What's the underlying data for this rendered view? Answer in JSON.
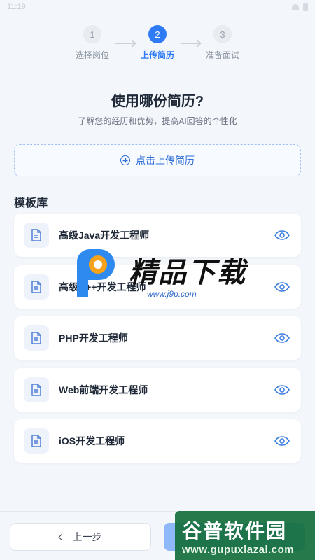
{
  "status_bar": {
    "time": "11:19"
  },
  "stepper": {
    "steps": [
      {
        "num": "1",
        "label": "选择岗位",
        "state": "done"
      },
      {
        "num": "2",
        "label": "上传简历",
        "state": "active"
      },
      {
        "num": "3",
        "label": "准备面试",
        "state": "todo"
      }
    ]
  },
  "heading": {
    "title": "使用哪份简历?",
    "subtitle": "了解您的经历和优势，提高AI回答的个性化"
  },
  "upload": {
    "label": "点击上传简历",
    "icon": "plus-circle-icon"
  },
  "templates": {
    "title": "模板库",
    "items": [
      {
        "label": "高级Java开发工程师"
      },
      {
        "label": "高级C++开发工程师"
      },
      {
        "label": "PHP开发工程师"
      },
      {
        "label": "Web前端开发工程师"
      },
      {
        "label": "iOS开发工程师"
      }
    ]
  },
  "footer": {
    "prev_label": "上一步",
    "next_label": ""
  },
  "watermarks": {
    "center_brand": "精品下载",
    "center_url": "www.j9p.com",
    "corner_brand": "谷普软件园",
    "corner_url": "www.gupuxlazal.com"
  },
  "colors": {
    "accent": "#2f7bf5",
    "background": "#f3f6fb",
    "card": "#ffffff"
  }
}
